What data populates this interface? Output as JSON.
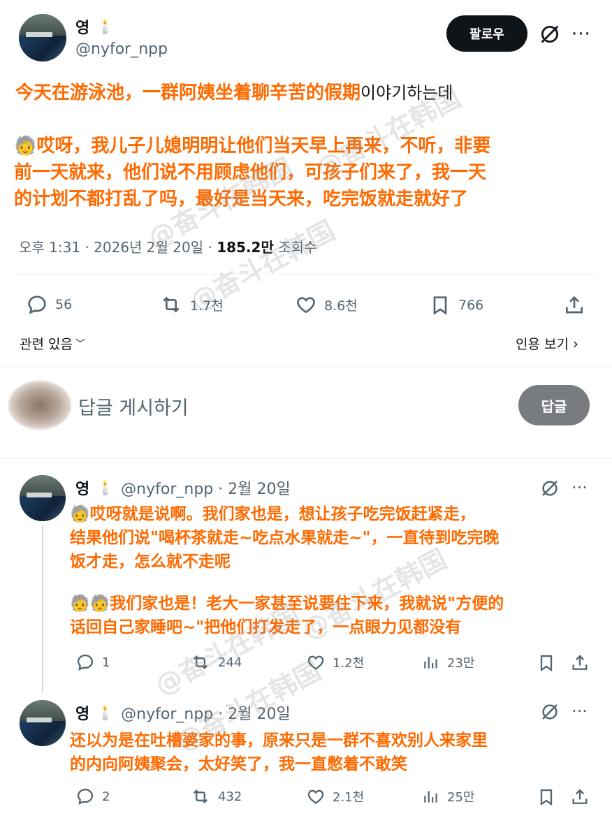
{
  "post": {
    "author_name": "영",
    "author_emoji": "🕯️",
    "author_handle": "@nyfor_npp",
    "follow_label": "팔로우",
    "text_zh_line1": "今天在游泳池，",
    "text_zh_line1b": "一群阿姨坐着聊辛苦的假期",
    "text_ko_tail1": "이야기하는데",
    "text_zh_line2": "🧓哎呀，我儿子儿媳明明让他们当天早上再来，不听，非要",
    "text_zh_line3": "前一天就来，他们说不用顾虑他们，可孩子们来了，我一天",
    "text_zh_line4": "的计划不都打乱了吗，最好是当天来，吃完饭就走就好了",
    "time": "오후 1:31 · 2026년 2월 20일 ·",
    "views_count": "185.2만",
    "views_label": "조회수",
    "stats": {
      "replies": "56",
      "retweets": "1.7천",
      "likes": "8.6천",
      "bookmarks": "766"
    },
    "related_label": "관련 있음",
    "quote_label": "인용 보기"
  },
  "composer": {
    "placeholder": "답글 게시하기",
    "button_label": "답글"
  },
  "replies": [
    {
      "author_name": "영",
      "author_emoji": "🕯️",
      "handle_date": "@nyfor_npp · 2월 20일",
      "zh_line1": "🧓哎呀就是说啊。我们家也是，想让孩子吃完饭赶紧走，",
      "zh_line2": "结果他们说\"喝杯茶就走~吃点水果就走~\"，一直待到吃完晚",
      "zh_line3": "饭才走，怎么就不走呢",
      "zh_line4": "🧓🧓我们家也是！老大一家甚至说要住下来，我就说\"方便的",
      "zh_line5": "话回自己家睡吧~\"把他们打发走了，一点眼力见都没有",
      "stats": {
        "replies": "1",
        "retweets": "244",
        "likes": "1.2천",
        "views": "23만"
      }
    },
    {
      "author_name": "영",
      "author_emoji": "🕯️",
      "handle_date": "@nyfor_npp · 2월 20일",
      "zh_line1": "还以为是在吐槽婆家的事，原来只是一群不喜欢别人来家里",
      "zh_line2": "的内向阿姨聚会，太好笑了，我一直憋着不敢笑",
      "stats": {
        "replies": "2",
        "retweets": "432",
        "likes": "2.1천",
        "views": "25만"
      }
    }
  ],
  "watermark": "@奋斗在韩国"
}
